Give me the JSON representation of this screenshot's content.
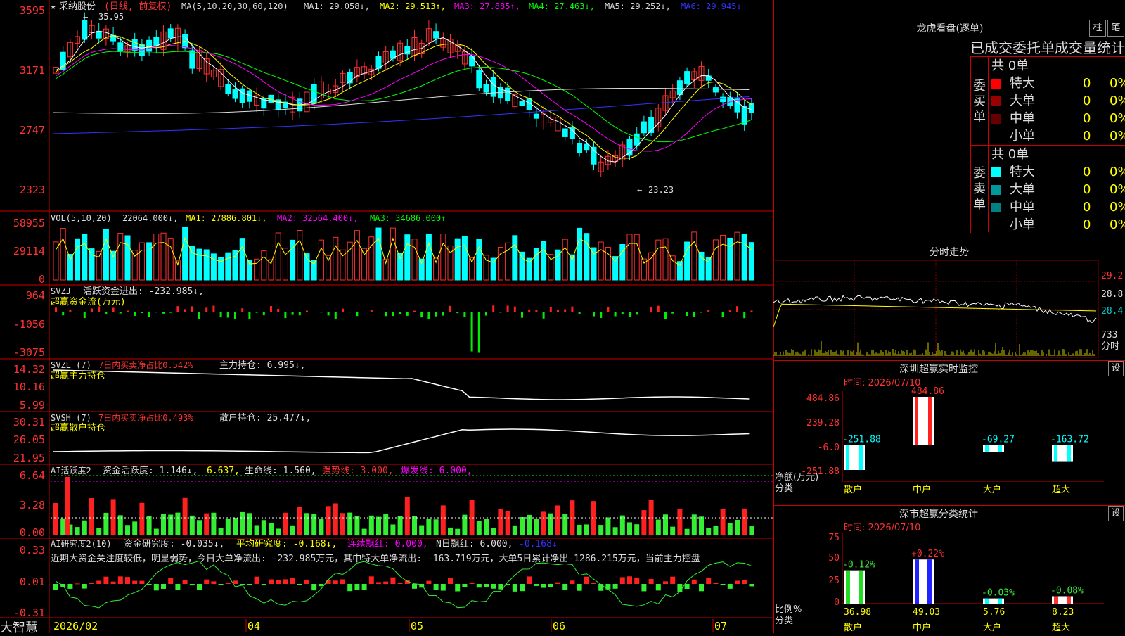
{
  "stock": {
    "name": "采纳股份",
    "period": "(日线, 前复权)",
    "ma_label": "MA(5,10,20,30,60,120)",
    "ma1": "MA1: 29.058↓,",
    "ma2": "MA2: 29.513↑,",
    "ma3": "MA3: 27.885↑,",
    "ma4": "MA4: 27.463↓,",
    "ma5": "MA5: 29.252↓,",
    "ma6": "MA6: 29.945↓",
    "high_note": "35.95",
    "low_note": "23.23",
    "price_axis": [
      "3595",
      "3171",
      "2747",
      "2323"
    ]
  },
  "vol": {
    "label": "VOL(5,10,20)",
    "v": "22064.000↓,",
    "ma1": "MA1: 27886.801↓,",
    "ma2": "MA2: 32564.400↓,",
    "ma3": "MA3: 34686.000↑",
    "axis": [
      "58955",
      "29114",
      "0"
    ]
  },
  "svzj": {
    "label": "SVZJ",
    "text": "活跃资金进出: -232.985↓,",
    "sub": "超赢资金流(万元)",
    "axis": [
      "964",
      "-1056",
      "-3075"
    ]
  },
  "svzl": {
    "label": "SVZL (7)",
    "t1": "7日内买卖净占比0.542%",
    "t2": "主力持仓: 6.995↓,",
    "sub": "超赢主力持仓",
    "axis": [
      "14.32",
      "10.16",
      "5.99"
    ]
  },
  "svsh": {
    "label": "SVSH (7)",
    "t1": "7日内买卖净占比0.493%",
    "t2": "散户持仓: 25.477↓,",
    "sub": "超赢散户持仓",
    "axis": [
      "30.31",
      "26.05",
      "21.95"
    ]
  },
  "ai1": {
    "label": "AI活跃度2",
    "t1": "资金活跃度: 1.146↓,",
    "t2": "6.637,",
    "t3": "生命线: 1.560,",
    "t4": "强势线: 3.000,",
    "t5": "爆发线: 6.000,",
    "axis": [
      "6.64",
      "3.28",
      "0.00"
    ]
  },
  "ai2": {
    "label": "AI研究度2(10)",
    "t1": "资金研究度: -0.035↓,",
    "t2": "平均研究度: -0.168↓,",
    "t3": "连续飘红: 0.000,",
    "t4": "N日飘红: 6.000,",
    "t5": "-0.168↓",
    "desc": "近期大资金关注度较低，明显弱势，今日大单净流出: -232.985万元，其中特大单净流出: -163.719万元，大单5日累计净出-1286.215万元，当前主力控盘",
    "axis": [
      "0.33",
      "0.01",
      "-0.31"
    ]
  },
  "dates": [
    "2026/02",
    "04",
    "05",
    "06",
    "07"
  ],
  "logo": "大智慧",
  "dragon": {
    "header": "龙虎看盘(逐单)",
    "btn_zhu": "柱",
    "btn_bi": "笔",
    "title": "已成交委托单成交量统计",
    "buy_side": "委买单",
    "sell_side": "委卖单",
    "buy_total": "共 0单",
    "sell_total": "共 0单",
    "buy_rows": [
      {
        "label": "特大",
        "count": "0",
        "pct": "0%",
        "color": "#ff0000"
      },
      {
        "label": "大单",
        "count": "0",
        "pct": "0%",
        "color": "#990000"
      },
      {
        "label": "中单",
        "count": "0",
        "pct": "0%",
        "color": "#660000"
      },
      {
        "label": "小单",
        "count": "0",
        "pct": "0%",
        "color": "#000000"
      }
    ],
    "sell_rows": [
      {
        "label": "特大",
        "count": "0",
        "pct": "0%",
        "color": "#00ffff"
      },
      {
        "label": "大单",
        "count": "0",
        "pct": "0%",
        "color": "#009999"
      },
      {
        "label": "中单",
        "count": "0",
        "pct": "0%",
        "color": "#008080"
      },
      {
        "label": "小单",
        "count": "0",
        "pct": "0%",
        "color": "#000000"
      }
    ]
  },
  "minute": {
    "header": "分时走势",
    "axis": [
      "29.2",
      "28.8",
      "28.4",
      "733"
    ],
    "label": "分时"
  },
  "monitor": {
    "header": "深圳超赢实时监控",
    "set": "设",
    "time": "时间: 2026/07/10",
    "unit_label": "净额(万元)",
    "class_label": "分类",
    "axis": [
      "484.86",
      "239.28",
      "-6.0",
      "-251.88"
    ]
  },
  "stats": {
    "header": "深市超赢分类统计",
    "set": "设",
    "time": "时间: 2026/07/10",
    "unit_label": "比例%",
    "class_label": "分类",
    "axis": [
      "75",
      "50",
      "25",
      "0"
    ]
  },
  "chart_data": [
    {
      "type": "bar",
      "title": "深圳超赢实时监控",
      "categories": [
        "散户",
        "中户",
        "大户",
        "超大"
      ],
      "values": [
        -251.88,
        484.86,
        -69.27,
        -163.72
      ],
      "ylim": [
        -251.88,
        484.86
      ],
      "colors": [
        "#00ffff",
        "#ff2020",
        "#00ffff",
        "#00ffff"
      ]
    },
    {
      "type": "bar",
      "title": "深市超赢分类统计",
      "categories": [
        "散户",
        "中户",
        "大户",
        "超大"
      ],
      "values": [
        36.98,
        49.03,
        5.76,
        8.23
      ],
      "changes": [
        "-0.12%",
        "+0.22%",
        "-0.03%",
        "-0.08%"
      ],
      "ylim": [
        0,
        75
      ],
      "colors": [
        "#22dd22",
        "#2222ff",
        "#00ffff",
        "#ff3333"
      ]
    }
  ]
}
